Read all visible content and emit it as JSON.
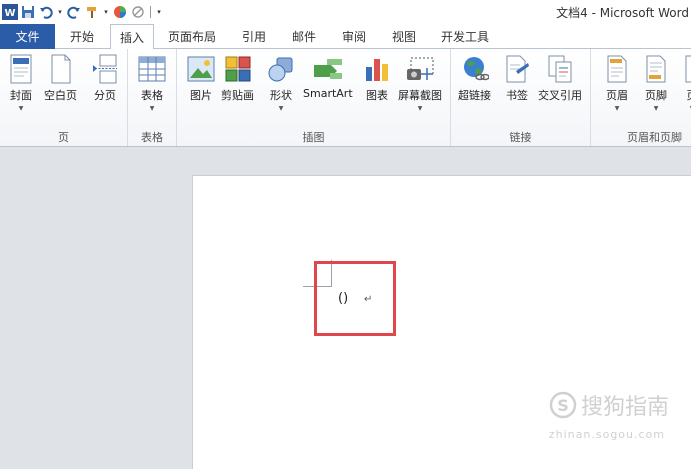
{
  "title_bar": {
    "doc_title": "文档4 - Microsoft Word"
  },
  "tabs": [
    {
      "label": "文件"
    },
    {
      "label": "开始"
    },
    {
      "label": "插入"
    },
    {
      "label": "页面布局"
    },
    {
      "label": "引用"
    },
    {
      "label": "邮件"
    },
    {
      "label": "审阅"
    },
    {
      "label": "视图"
    },
    {
      "label": "开发工具"
    }
  ],
  "active_tab": "插入",
  "ribbon": {
    "groups": [
      {
        "label": "页",
        "buttons": [
          {
            "label": "封面"
          },
          {
            "label": "空白页"
          },
          {
            "label": "分页"
          }
        ]
      },
      {
        "label": "表格",
        "buttons": [
          {
            "label": "表格"
          }
        ]
      },
      {
        "label": "插图",
        "buttons": [
          {
            "label": "图片"
          },
          {
            "label": "剪贴画"
          },
          {
            "label": "形状"
          },
          {
            "label": "SmartArt"
          },
          {
            "label": "图表"
          },
          {
            "label": "屏幕截图"
          }
        ]
      },
      {
        "label": "链接",
        "buttons": [
          {
            "label": "超链接"
          },
          {
            "label": "书签"
          },
          {
            "label": "交叉引用"
          }
        ]
      },
      {
        "label": "页眉和页脚",
        "buttons": [
          {
            "label": "页眉"
          },
          {
            "label": "页脚"
          },
          {
            "label": "页"
          }
        ]
      }
    ]
  },
  "document": {
    "paren_text": "()",
    "para_mark": "↵"
  },
  "watermark": {
    "text": "搜狗指南",
    "url": "zhinan.sogou.com"
  },
  "colors": {
    "file_tab": "#2a5ca8",
    "highlight": "#e0474c",
    "workarea": "#dfe3e8"
  }
}
